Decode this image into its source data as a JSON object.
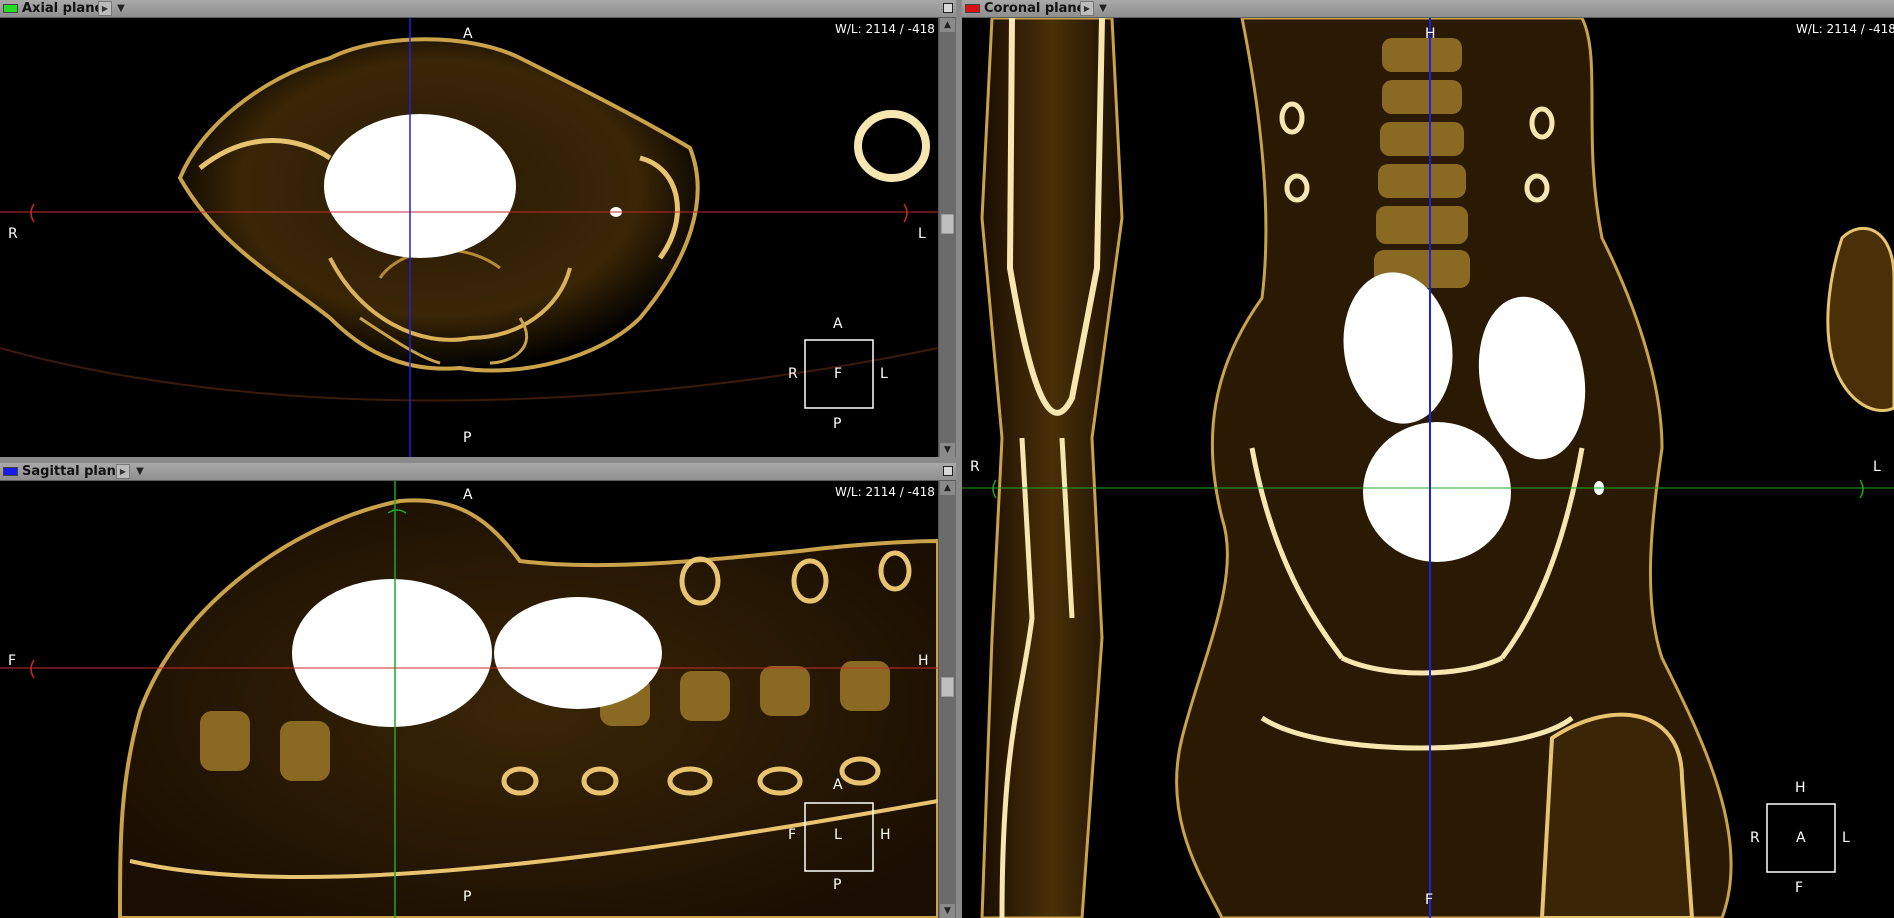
{
  "panels": {
    "axial": {
      "title": "Axial plane",
      "wl": "W/L: 2114 / -418",
      "swatch_color": "#22dd22",
      "orient": {
        "top": "A",
        "bottom": "P",
        "left": "R",
        "right": "L"
      },
      "cube": {
        "top": "A",
        "bottom": "P",
        "left": "R",
        "right": "L",
        "center": "F"
      }
    },
    "sagittal": {
      "title": "Sagittal plane",
      "wl": "W/L: 2114 / -418",
      "swatch_color": "#1a1aee",
      "orient": {
        "top": "A",
        "bottom": "P",
        "left": "F",
        "right": "H"
      },
      "cube": {
        "top": "A",
        "bottom": "P",
        "left": "F",
        "right": "H",
        "center": "L"
      }
    },
    "coronal": {
      "title": "Coronal plane",
      "wl": "W/L: 2114 / -418",
      "swatch_color": "#dd1111",
      "orient": {
        "top": "H",
        "bottom": "F",
        "left": "R",
        "right": "L"
      },
      "cube": {
        "top": "H",
        "bottom": "F",
        "left": "R",
        "right": "L",
        "center": "A"
      }
    }
  },
  "icons": {
    "play": "play-arrow-icon",
    "dropdown": "chevron-down-icon",
    "maximize": "maximize-icon"
  },
  "colors": {
    "bone": "#f0d58a",
    "tissue": "#5a3a08",
    "crosshair_red": "#c82a2a",
    "crosshair_green": "#1fa81f",
    "crosshair_blue": "#2020e0"
  }
}
